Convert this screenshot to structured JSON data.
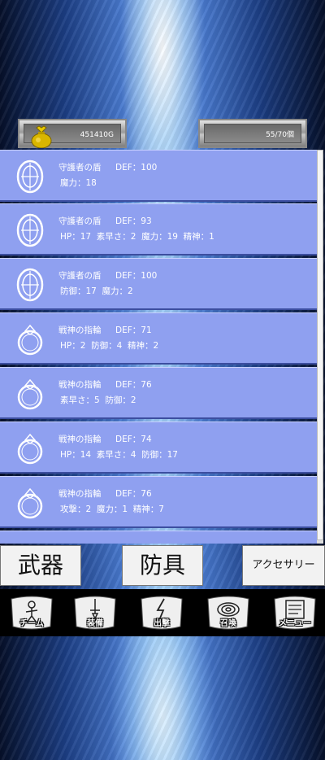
{
  "currency": {
    "gold": "451410G",
    "icon": "gold-bag-icon"
  },
  "inventory": {
    "count": "55/70個"
  },
  "items": [
    {
      "name": "守護者の盾",
      "def": "DEF：100",
      "stats": "魔力：18",
      "icon": "shield-icon"
    },
    {
      "name": "守護者の盾",
      "def": "DEF：93",
      "stats": "HP：17  素早さ：2  魔力：19  精神：1",
      "icon": "shield-icon"
    },
    {
      "name": "守護者の盾",
      "def": "DEF：100",
      "stats": "防御：17  魔力：2",
      "icon": "shield-icon"
    },
    {
      "name": "戦神の指輪",
      "def": "DEF：71",
      "stats": "HP：2  防御：4  精神：2",
      "icon": "ring-icon"
    },
    {
      "name": "戦神の指輪",
      "def": "DEF：76",
      "stats": "素早さ：5  防御：2",
      "icon": "ring-icon"
    },
    {
      "name": "戦神の指輪",
      "def": "DEF：74",
      "stats": "HP：14  素早さ：4  防御：17",
      "icon": "ring-icon"
    },
    {
      "name": "戦神の指輪",
      "def": "DEF：76",
      "stats": "攻撃：2  魔力：1  精神：7",
      "icon": "ring-icon"
    }
  ],
  "tabs": {
    "weapon": "武器",
    "armor": "防具",
    "accessory": "アクセサリー"
  },
  "nav": {
    "team": "チーム",
    "equip": "装備",
    "sortie": "出撃",
    "summon": "召喚",
    "menu": "メニュー"
  }
}
